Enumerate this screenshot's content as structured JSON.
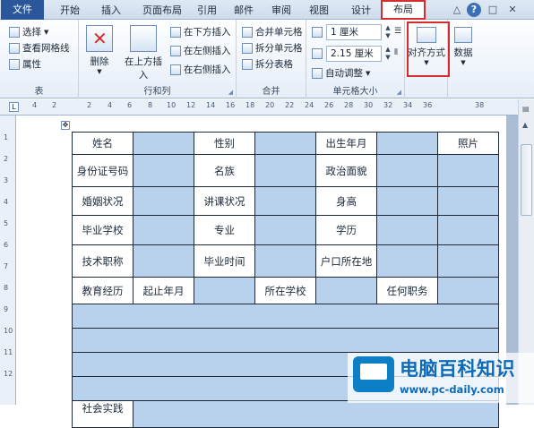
{
  "tabs": {
    "file": "文件",
    "home": "开始",
    "insert": "插入",
    "page_layout": "页面布局",
    "references": "引用",
    "mailings": "邮件",
    "review": "审阅",
    "view": "视图",
    "design": "设计",
    "layout": "布局"
  },
  "window": {
    "minimize": "△",
    "help": "?",
    "restore": "□",
    "close": "✕"
  },
  "ribbon": {
    "table": {
      "label": "表",
      "select": "选择",
      "gridlines": "查看网格线",
      "properties": "属性"
    },
    "rows_cols": {
      "label": "行和列",
      "delete": "删除",
      "insert_above": "在上方插入",
      "insert_below": "在下方插入",
      "insert_left": "在左侧插入",
      "insert_right": "在右侧插入"
    },
    "merge": {
      "label": "合并",
      "merge_cells": "合并单元格",
      "split_cells": "拆分单元格",
      "split_table": "拆分表格"
    },
    "cell_size": {
      "label": "单元格大小",
      "height": "1 厘米",
      "width": "2.15 厘米",
      "autofit": "自动调整"
    },
    "alignment": {
      "label": "对齐方式"
    },
    "data": {
      "label": "数据"
    }
  },
  "ruler": {
    "marks": [
      "4",
      "2",
      "2",
      "4",
      "6",
      "8",
      "10",
      "12",
      "14",
      "16",
      "18",
      "20",
      "22",
      "24",
      "26",
      "28",
      "30",
      "32",
      "34",
      "36",
      "38"
    ]
  },
  "vruler": {
    "marks": [
      "1",
      "2",
      "3",
      "4",
      "5",
      "6",
      "7",
      "8",
      "9",
      "10",
      "11",
      "12"
    ]
  },
  "table": {
    "name": "姓名",
    "gender": "性别",
    "birth": "出生年月",
    "photo": "照片",
    "id_no": "身份证号码",
    "ethnic": "名族",
    "political": "政治面貌",
    "marital": "婚姻状况",
    "teaching": "讲课状况",
    "height": "身高",
    "school": "毕业学校",
    "major": "专业",
    "education": "学历",
    "title": "技术职称",
    "grad_time": "毕业时间",
    "hukou": "户口所在地",
    "edu_hist": "教育经历",
    "start_end": "起止年月",
    "school_at": "所在学校",
    "post": "任何职务",
    "social": "社会实践"
  },
  "watermark": {
    "title": "电脑百科知识",
    "url": "www.pc-daily.com"
  }
}
